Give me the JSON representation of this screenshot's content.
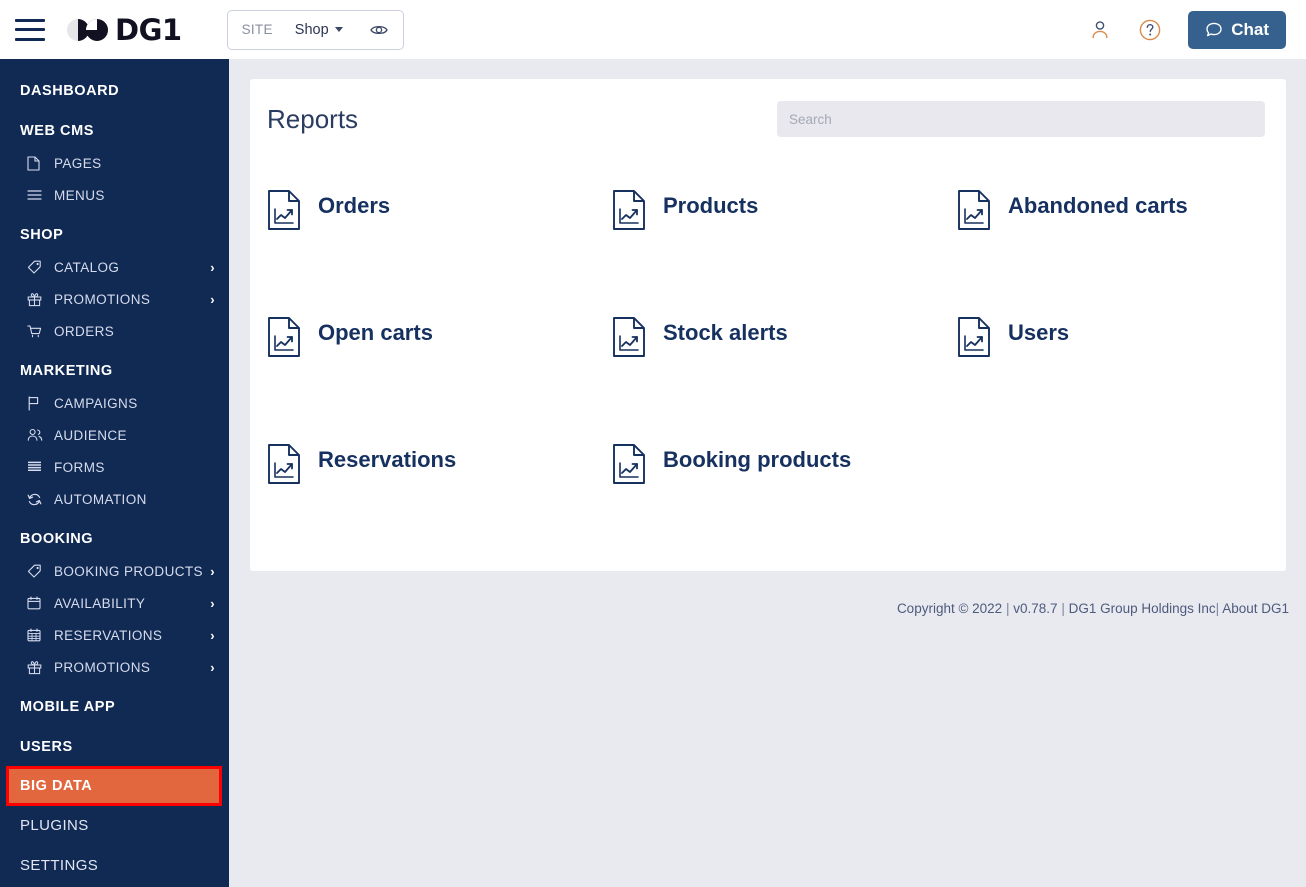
{
  "header": {
    "menu_icon": "hamburger-icon",
    "logo_text": "DG1",
    "site_label": "SITE",
    "site_value": "Shop",
    "preview_icon": "eye-icon",
    "account_icon": "person-icon",
    "help_icon": "question-circle-icon",
    "chat_label": "Chat",
    "chat_icon": "chat-bubble-icon",
    "chat_bg": "#36618e"
  },
  "sidebar": {
    "bg": "#102a54",
    "highlight_bg": "#e2673f",
    "highlight_outline": "#ff0000",
    "groups": [
      {
        "label": "DASHBOARD",
        "type": "group"
      },
      {
        "label": "WEB CMS",
        "type": "group"
      },
      {
        "label": "PAGES",
        "type": "item",
        "icon": "file-icon"
      },
      {
        "label": "MENUS",
        "type": "item",
        "icon": "list-icon"
      },
      {
        "label": "SHOP",
        "type": "group"
      },
      {
        "label": "CATALOG",
        "type": "item",
        "icon": "tag-icon",
        "chevron": "›"
      },
      {
        "label": "PROMOTIONS",
        "type": "item",
        "icon": "gift-icon",
        "chevron": "›"
      },
      {
        "label": "ORDERS",
        "type": "item",
        "icon": "cart-icon"
      },
      {
        "label": "MARKETING",
        "type": "group"
      },
      {
        "label": "CAMPAIGNS",
        "type": "item",
        "icon": "flag-icon"
      },
      {
        "label": "AUDIENCE",
        "type": "item",
        "icon": "people-icon"
      },
      {
        "label": "FORMS",
        "type": "item",
        "icon": "form-icon"
      },
      {
        "label": "AUTOMATION",
        "type": "item",
        "icon": "refresh-icon"
      },
      {
        "label": "BOOKING",
        "type": "group"
      },
      {
        "label": "BOOKING PRODUCTS",
        "type": "item",
        "icon": "tag-icon",
        "chevron": "›"
      },
      {
        "label": "AVAILABILITY",
        "type": "item",
        "icon": "calendar-icon",
        "chevron": "›"
      },
      {
        "label": "RESERVATIONS",
        "type": "item",
        "icon": "calendar-grid-icon",
        "chevron": "›"
      },
      {
        "label": "PROMOTIONS",
        "type": "item",
        "icon": "gift-icon",
        "chevron": "›"
      },
      {
        "label": "MOBILE APP",
        "type": "group"
      },
      {
        "label": "USERS",
        "type": "group"
      },
      {
        "label": "BIG DATA",
        "type": "group-active"
      },
      {
        "label": "PLUGINS",
        "type": "plain"
      },
      {
        "label": "SETTINGS",
        "type": "plain"
      }
    ]
  },
  "main": {
    "title": "Reports",
    "search_placeholder": "Search",
    "search_value": "",
    "reports": [
      {
        "label": "Orders",
        "icon": "report-chart-document-icon"
      },
      {
        "label": "Products",
        "icon": "report-chart-document-icon"
      },
      {
        "label": "Abandoned carts",
        "icon": "report-chart-document-icon"
      },
      {
        "label": "Open carts",
        "icon": "report-chart-document-icon"
      },
      {
        "label": "Stock alerts",
        "icon": "report-chart-document-icon"
      },
      {
        "label": "Users",
        "icon": "report-chart-document-icon"
      },
      {
        "label": "Reservations",
        "icon": "report-chart-document-icon"
      },
      {
        "label": "Booking products",
        "icon": "report-chart-document-icon"
      }
    ]
  },
  "footer": {
    "copyright": "Copyright © 2022",
    "version": "v0.78.7",
    "company": "DG1 Group Holdings Inc",
    "about_link": "About DG1",
    "separator": "|"
  }
}
